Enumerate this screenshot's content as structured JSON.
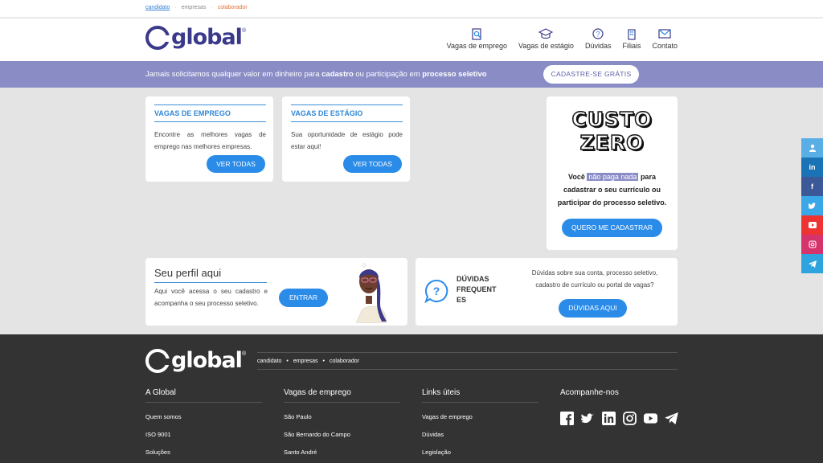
{
  "topbar": {
    "crumbs": [
      "candidato",
      "empresas",
      "colaborador"
    ]
  },
  "header": {
    "logo_text": "global",
    "nav": [
      "Vagas de emprego",
      "Vagas de estágio",
      "Dúvidas",
      "Filiais",
      "Contato"
    ]
  },
  "banner": {
    "text_1": "Jamais solicitamos qualquer valor em dinheiro para ",
    "bold_1": "cadastro",
    "text_2": " ou participação em ",
    "bold_2": "processo seletivo",
    "button": "CADASTRE-SE GRÁTIS"
  },
  "cards": {
    "emprego": {
      "title": "VAGAS DE EMPREGO",
      "desc": "Encontre as melhores vagas de emprego nas melhores empresas.",
      "button": "VER TODAS"
    },
    "estagio": {
      "title": "VAGAS DE ESTÁGIO",
      "desc": "Sua oportunidade de estágio pode estar aqui!",
      "button": "VER TODAS"
    }
  },
  "custo": {
    "line1": "CUSTO",
    "line2": "ZERO",
    "text_1": "Você ",
    "highlight": "não paga nada",
    "text_2": " para cadastrar o seu currículo ou participar do processo seletivo.",
    "button": "QUERO ME CADASTRAR"
  },
  "perfil": {
    "title": "Seu perfil aqui",
    "desc": "Aqui você acessa o seu cadastro e acompanha o seu processo seletivo.",
    "button": "ENTRAR"
  },
  "duvidas": {
    "l1": "DÚVIDAS",
    "l2": "FREQUENT",
    "l3": "ES",
    "desc": "Dúvidas sobre sua conta, processo seletivo, cadastro de currículo ou portal de vagas?",
    "button": "DÚVIDAS AQUI"
  },
  "footer": {
    "logo_text": "global",
    "links": [
      "candidato",
      "empresas",
      "colaborador"
    ],
    "cols": [
      {
        "title": "A Global",
        "items": [
          "Quem somos",
          "ISO 9001",
          "Soluções"
        ]
      },
      {
        "title": "Vagas de emprego",
        "items": [
          "São Paulo",
          "São Bernardo do Campo",
          "Santo André"
        ]
      },
      {
        "title": "Links úteis",
        "items": [
          "Vagas de emprego",
          "Dúvidas",
          "Legislação"
        ]
      }
    ],
    "social_title": "Acompanhe-nos"
  },
  "colors": {
    "primary": "#3b3a8a",
    "banner": "#8a8cc6",
    "button": "#2a8be8",
    "footer": "#333333"
  },
  "social_sidebar": [
    "user-icon",
    "linkedin-icon",
    "facebook-icon",
    "twitter-icon",
    "youtube-icon",
    "instagram-icon",
    "telegram-icon"
  ]
}
